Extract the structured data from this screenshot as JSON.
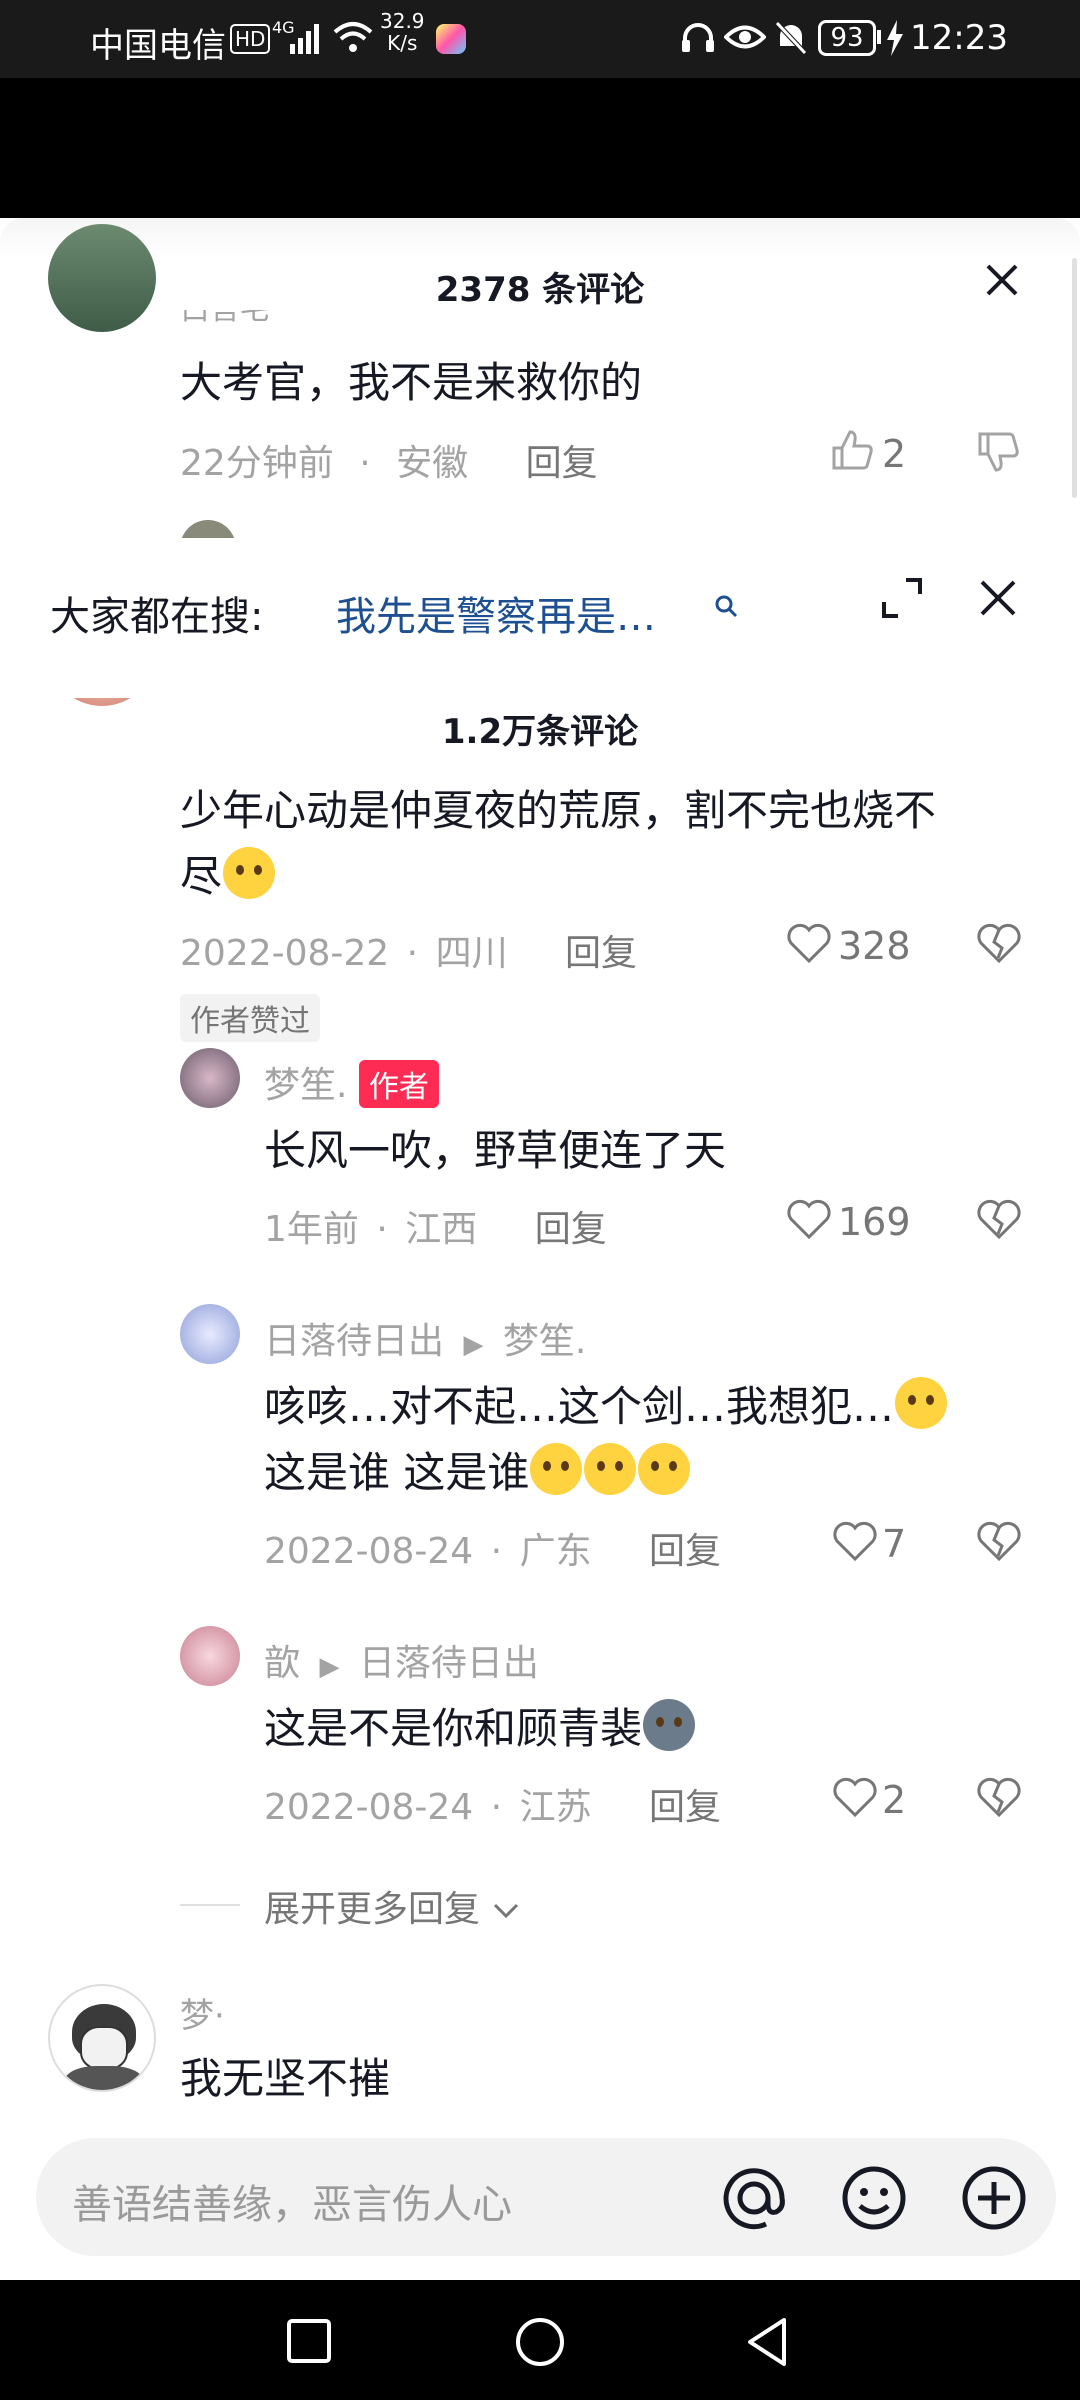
{
  "status_bar": {
    "carrier": "中国电信",
    "hd": "HD",
    "net_type": "4G",
    "speed_value": "32.9",
    "speed_unit": "K/s",
    "battery": "93",
    "time": "12:23"
  },
  "overlay_comments": {
    "title": "2378 条评论",
    "comment": {
      "username": "白菩宅",
      "text": "大考官，我不是来救你的",
      "time": "22分钟前",
      "location": "安徽",
      "reply_label": "回复",
      "likes": "2"
    }
  },
  "search_bar": {
    "label": "大家都在搜:",
    "query": "我先是警察再是…"
  },
  "comments": {
    "title": "1.2万条评论",
    "main": {
      "text_line1": "少年心动是仲夏夜的荒原，割不完也烧不",
      "text_line2": "尽",
      "date": "2022-08-22",
      "location": "四川",
      "reply_label": "回复",
      "likes": "328",
      "author_liked_tag": "作者赞过"
    },
    "replies": [
      {
        "username": "梦笙.",
        "author_badge": "作者",
        "text": "长风一吹，野草便连了天",
        "date": "1年前",
        "location": "江西",
        "reply_label": "回复",
        "likes": "169"
      },
      {
        "username": "日落待日出",
        "reply_to": "梦笙.",
        "text_line1": "咳咳…对不起…这个剑…我想犯…",
        "text_line2": "这是谁  这是谁",
        "date": "2022-08-24",
        "location": "广东",
        "reply_label": "回复",
        "likes": "7"
      },
      {
        "username": "歆",
        "reply_to": "日落待日出",
        "text": "这是不是你和顾青裴",
        "date": "2022-08-24",
        "location": "江苏",
        "reply_label": "回复",
        "likes": "2"
      }
    ],
    "expand_label": "展开更多回复",
    "next": {
      "username": "梦·",
      "text": "我无坚不摧"
    }
  },
  "input_bar": {
    "placeholder": "善语结善缘，恶言伤人心"
  },
  "icons": {
    "close": "close-icon",
    "expand": "expand-icon",
    "search": "search-icon",
    "like": "heart-icon",
    "dislike": "broken-heart-icon",
    "thumb_up": "thumb-up-icon",
    "thumb_down": "thumb-down-icon",
    "at": "at-icon",
    "emoji": "emoji-icon",
    "add": "add-icon"
  },
  "colors": {
    "accent": "#fe2c55",
    "link": "#1d4f91"
  }
}
